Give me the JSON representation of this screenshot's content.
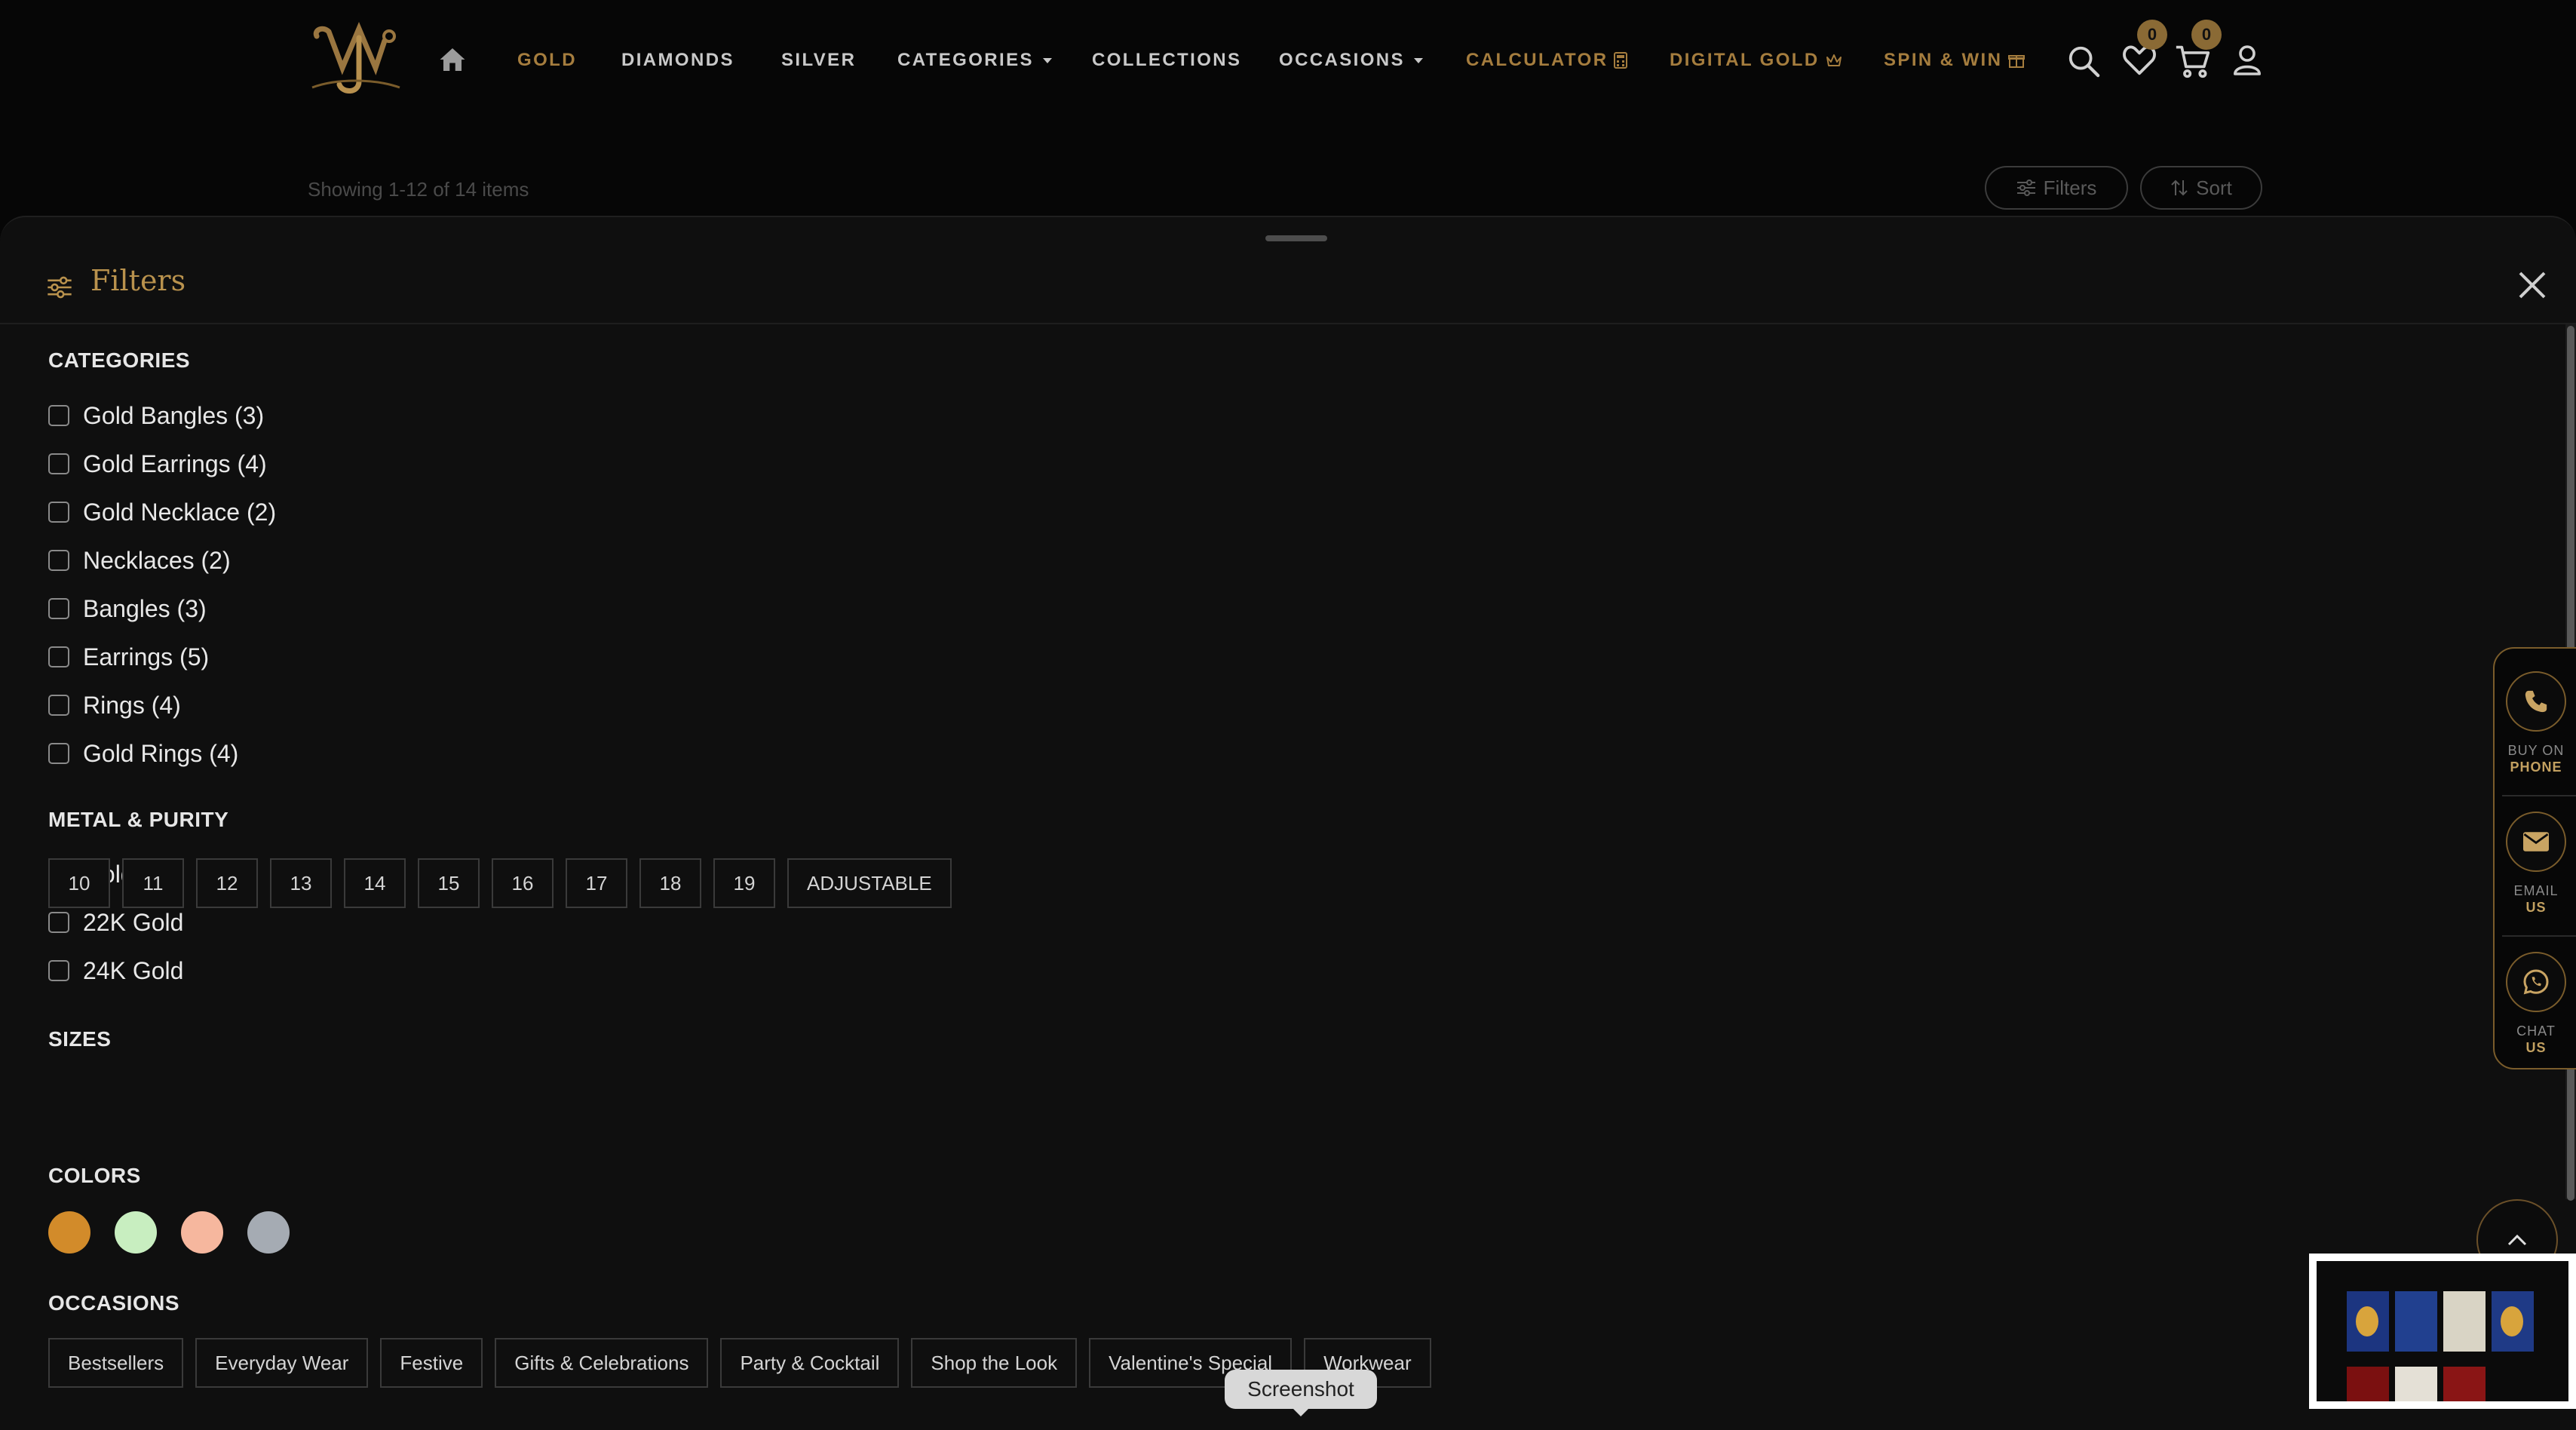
{
  "header": {
    "nav": [
      {
        "label": "GOLD"
      },
      {
        "label": "DIAMONDS"
      },
      {
        "label": "SILVER"
      },
      {
        "label": "CATEGORIES"
      },
      {
        "label": "COLLECTIONS"
      },
      {
        "label": "OCCASIONS"
      },
      {
        "label": "CALCULATOR"
      },
      {
        "label": "DIGITAL GOLD"
      },
      {
        "label": "SPIN & WIN"
      }
    ],
    "wishlist_count": "0",
    "cart_count": "0"
  },
  "listing": {
    "showing_text": "Showing 1-12 of 14 items",
    "filters_label": "Filters",
    "sort_label": "Sort"
  },
  "filters": {
    "title": "Filters",
    "categories_title": "CATEGORIES",
    "categories": [
      {
        "label": "Gold Bangles (3)",
        "checked": false
      },
      {
        "label": "Gold Earrings (4)",
        "checked": false
      },
      {
        "label": "Gold Necklace (2)",
        "checked": false
      },
      {
        "label": "Necklaces (2)",
        "checked": false
      },
      {
        "label": "Bangles (3)",
        "checked": false
      },
      {
        "label": "Earrings (5)",
        "checked": false
      },
      {
        "label": "Rings (4)",
        "checked": false
      },
      {
        "label": "Gold Rings (4)",
        "checked": false
      }
    ],
    "metal_title": "METAL & PURITY",
    "metals": [
      {
        "label": "Gold",
        "checked": true
      },
      {
        "label": "22K Gold",
        "checked": false
      },
      {
        "label": "24K Gold",
        "checked": false
      }
    ],
    "sizes_title": "SIZES",
    "sizes": [
      "10",
      "11",
      "12",
      "13",
      "14",
      "15",
      "16",
      "17",
      "18",
      "19",
      "ADJUSTABLE"
    ],
    "colors_title": "COLORS",
    "colors": [
      "#d28b2a",
      "#c8eec0",
      "#f6b79e",
      "#a5abb3"
    ],
    "occasions_title": "OCCASIONS",
    "occasions": [
      "Bestsellers",
      "Everyday Wear",
      "Festive",
      "Gifts & Celebrations",
      "Party & Cocktail",
      "Shop the Look",
      "Valentine's Special",
      "Workwear"
    ]
  },
  "contact": {
    "phone": {
      "line1": "BUY ON",
      "line2": "PHONE"
    },
    "email": {
      "line1": "EMAIL",
      "line2": "US"
    },
    "chat": {
      "line1": "CHAT",
      "line2": "US"
    }
  },
  "tooltip": "Screenshot",
  "theme": {
    "accent": "#a57d3e",
    "background": "#060606",
    "panel": "#0f0f0f"
  }
}
